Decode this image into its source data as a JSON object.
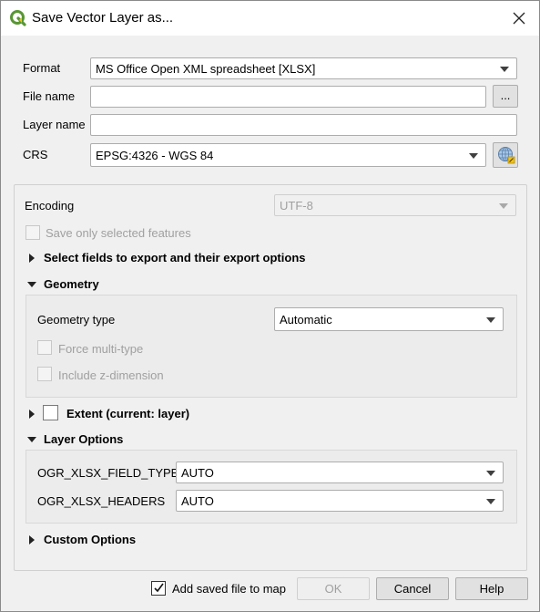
{
  "window": {
    "title": "Save Vector Layer as..."
  },
  "form": {
    "format_label": "Format",
    "format_value": "MS Office Open XML spreadsheet [XLSX]",
    "filename_label": "File name",
    "filename_value": "",
    "browse_label": "...",
    "layername_label": "Layer name",
    "layername_value": "",
    "crs_label": "CRS",
    "crs_value": "EPSG:4326 - WGS 84"
  },
  "options": {
    "encoding_label": "Encoding",
    "encoding_value": "UTF-8",
    "selected_only_label": "Save only selected features",
    "select_fields_label": "Select fields to export and their export options",
    "geometry_label": "Geometry",
    "geometry_type_label": "Geometry type",
    "geometry_type_value": "Automatic",
    "force_multi_label": "Force multi-type",
    "include_z_label": "Include z-dimension",
    "extent_label": "Extent (current: layer)",
    "layer_options_label": "Layer Options",
    "field_types_label": "OGR_XLSX_FIELD_TYPES",
    "field_types_value": "AUTO",
    "headers_label": "OGR_XLSX_HEADERS",
    "headers_value": "AUTO",
    "custom_options_label": "Custom Options"
  },
  "footer": {
    "add_to_map_label": "Add saved file to map",
    "add_to_map_checked": true,
    "ok_label": "OK",
    "cancel_label": "Cancel",
    "help_label": "Help"
  },
  "colors": {
    "qgis_green": "#589632",
    "qgis_yellow": "#f0c419"
  }
}
